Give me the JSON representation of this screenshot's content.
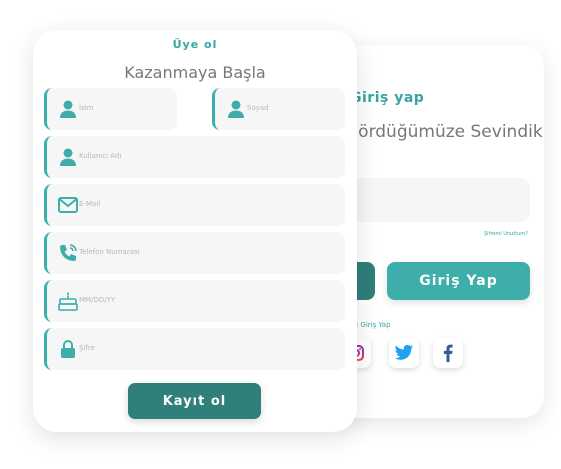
{
  "login": {
    "title": "Giriş yap",
    "welcome": "Gördüğümüze Sevindik.",
    "forgot": "Şifremi Unuttum?",
    "login_button": "Giriş Yap",
    "social_label": "ile Giriş Yap",
    "social_icons": [
      "instagram-icon",
      "twitter-icon",
      "facebook-icon"
    ]
  },
  "register": {
    "title": "Üye ol",
    "subtitle": "Kazanmaya Başla",
    "fields": {
      "first_name": "İsim",
      "last_name": "Soyad",
      "username": "Kullanıcı Adı",
      "email": "E-Mail",
      "phone": "Telefon Numarası",
      "birthdate": "MM/DD/YY",
      "password": "Şifre"
    },
    "submit": "Kayıt ol"
  },
  "colors": {
    "accent": "#3daea9",
    "dark_accent": "#2f7f7b",
    "field_bg": "#f6f6f6"
  }
}
